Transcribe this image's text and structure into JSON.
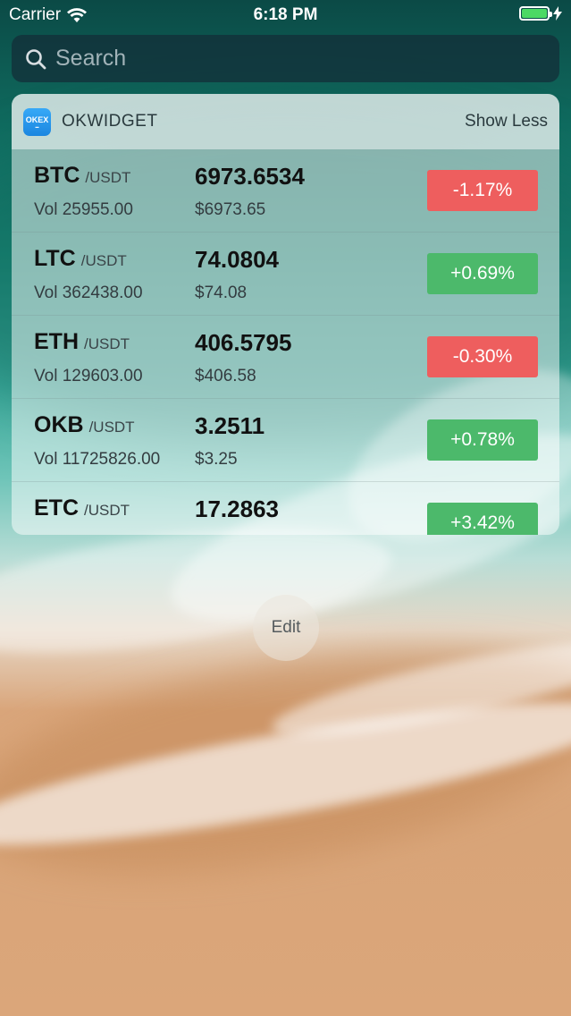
{
  "status_bar": {
    "carrier": "Carrier",
    "time": "6:18 PM",
    "battery_level": 1.0
  },
  "search": {
    "placeholder": "Search"
  },
  "widget": {
    "app_icon_text": "OKEX",
    "title": "OKWIDGET",
    "show_less_label": "Show Less",
    "rows": [
      {
        "symbol": "BTC",
        "quote": "/USDT",
        "price": "6973.6534",
        "vol": "Vol 25955.00",
        "usd": "$6973.65",
        "change": "-1.17%",
        "direction": "down"
      },
      {
        "symbol": "LTC",
        "quote": "/USDT",
        "price": "74.0804",
        "vol": "Vol 362438.00",
        "usd": "$74.08",
        "change": "+0.69%",
        "direction": "up"
      },
      {
        "symbol": "ETH",
        "quote": "/USDT",
        "price": "406.5795",
        "vol": "Vol 129603.00",
        "usd": "$406.58",
        "change": "-0.30%",
        "direction": "down"
      },
      {
        "symbol": "OKB",
        "quote": "/USDT",
        "price": "3.2511",
        "vol": "Vol 11725826.00",
        "usd": "$3.25",
        "change": "+0.78%",
        "direction": "up"
      },
      {
        "symbol": "ETC",
        "quote": "/USDT",
        "price": "17.2863",
        "vol": "",
        "usd": "",
        "change": "+3.42%",
        "direction": "up"
      }
    ]
  },
  "edit_label": "Edit",
  "colors": {
    "negative": "#ee5e5e",
    "positive": "#4cb96b",
    "battery": "#4cd964"
  }
}
